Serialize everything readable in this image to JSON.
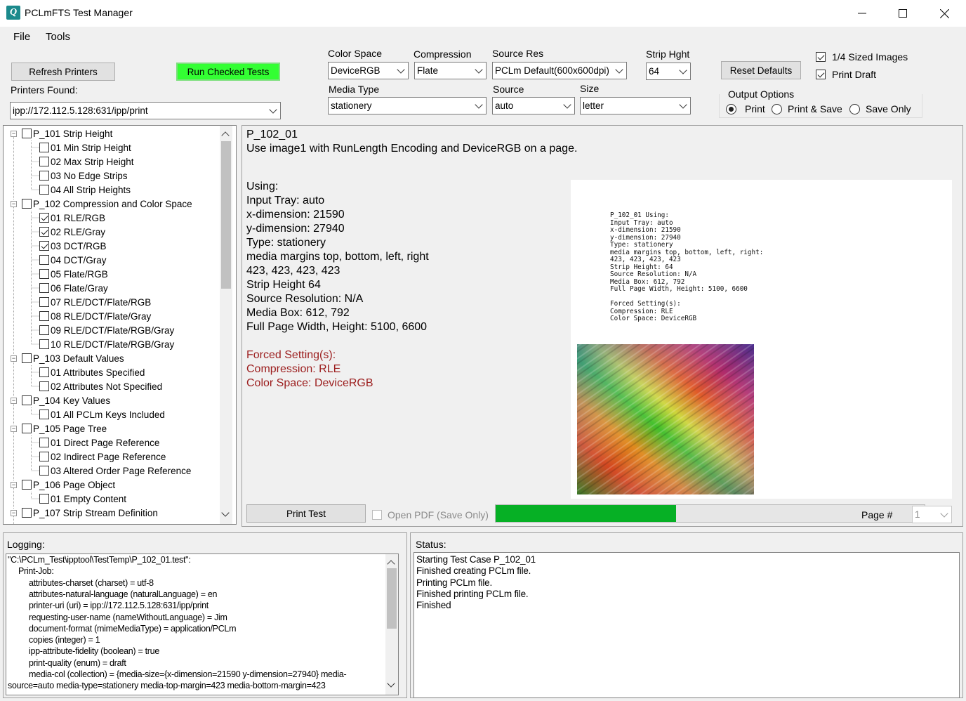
{
  "window": {
    "title": "PCLmFTS Test Manager",
    "app_icon_glyph": "Q",
    "controls": {
      "minimize": "minimize-icon",
      "maximize": "maximize-icon",
      "close": "close-icon"
    }
  },
  "menu": {
    "items": [
      "File",
      "Tools"
    ]
  },
  "toolbar": {
    "refresh_label": "Refresh Printers",
    "run_label": "Run Checked Tests",
    "run_color": "#33ff33",
    "printers_found_label": "Printers Found:",
    "printer": "ipp://172.112.5.128:631/ipp/print",
    "reset_label": "Reset Defaults",
    "color_space": {
      "label": "Color Space",
      "value": "DeviceRGB"
    },
    "compression": {
      "label": "Compression",
      "value": "Flate"
    },
    "source_res": {
      "label": "Source Res",
      "value": "PCLm Default(600x600dpi)"
    },
    "strip_height": {
      "label": "Strip Hght",
      "value": "64"
    },
    "media_type": {
      "label": "Media Type",
      "value": "stationery"
    },
    "source": {
      "label": "Source",
      "value": "auto"
    },
    "size": {
      "label": "Size",
      "value": "letter"
    },
    "quarter_sized": {
      "label": "1/4 Sized Images",
      "checked": true
    },
    "print_draft": {
      "label": "Print Draft",
      "checked": true
    },
    "output_options": {
      "label": "Output Options",
      "options": [
        "Print",
        "Print & Save",
        "Save Only"
      ],
      "selected": "Print"
    }
  },
  "tree": {
    "items": [
      {
        "label": "P_101 Strip Height",
        "level": 0,
        "checked": false
      },
      {
        "label": "01 Min Strip Height",
        "level": 1,
        "checked": false
      },
      {
        "label": "02 Max Strip Height",
        "level": 1,
        "checked": false
      },
      {
        "label": "03 No Edge Strips",
        "level": 1,
        "checked": false
      },
      {
        "label": "04 All Strip Heights",
        "level": 1,
        "checked": false
      },
      {
        "label": "P_102 Compression and Color Space",
        "level": 0,
        "checked": false
      },
      {
        "label": "01 RLE/RGB",
        "level": 1,
        "checked": true
      },
      {
        "label": "02 RLE/Gray",
        "level": 1,
        "checked": true
      },
      {
        "label": "03 DCT/RGB",
        "level": 1,
        "checked": true
      },
      {
        "label": "04 DCT/Gray",
        "level": 1,
        "checked": false
      },
      {
        "label": "05 Flate/RGB",
        "level": 1,
        "checked": false
      },
      {
        "label": "06 Flate/Gray",
        "level": 1,
        "checked": false
      },
      {
        "label": "07 RLE/DCT/Flate/RGB",
        "level": 1,
        "checked": false
      },
      {
        "label": "08 RLE/DCT/Flate/Gray",
        "level": 1,
        "checked": false
      },
      {
        "label": "09 RLE/DCT/Flate/RGB/Gray",
        "level": 1,
        "checked": false
      },
      {
        "label": "10 RLE/DCT/Flate/RGB/Gray",
        "level": 1,
        "checked": false
      },
      {
        "label": "P_103 Default Values",
        "level": 0,
        "checked": false
      },
      {
        "label": "01 Attributes Specified",
        "level": 1,
        "checked": false
      },
      {
        "label": "02 Attributes Not Specified",
        "level": 1,
        "checked": false
      },
      {
        "label": "P_104 Key Values",
        "level": 0,
        "checked": false
      },
      {
        "label": "01 All PCLm Keys Included",
        "level": 1,
        "checked": false
      },
      {
        "label": "P_105 Page Tree",
        "level": 0,
        "checked": false
      },
      {
        "label": "01 Direct Page Reference",
        "level": 1,
        "checked": false
      },
      {
        "label": "02 Indirect Page Reference",
        "level": 1,
        "checked": false
      },
      {
        "label": "03 Altered Order Page Reference",
        "level": 1,
        "checked": false
      },
      {
        "label": "P_106 Page Object",
        "level": 0,
        "checked": false
      },
      {
        "label": "01 Empty Content",
        "level": 1,
        "checked": false
      },
      {
        "label": "P_107 Strip Stream Definition",
        "level": 0,
        "checked": false
      }
    ]
  },
  "detail": {
    "test_id": "P_102_01",
    "description": "Use image1 with RunLength Encoding and DeviceRGB on a page.",
    "using": [
      "Using:",
      "Input Tray: auto",
      "x-dimension: 21590",
      "y-dimension: 27940",
      "Type: stationery",
      "media margins top, bottom, left, right",
      "423, 423, 423, 423",
      "Strip Height 64",
      "Source Resolution: N/A",
      "Media Box: 612, 792",
      "Full Page Width, Height: 5100, 6600"
    ],
    "forced": [
      "Forced Setting(s):",
      "Compression: RLE",
      "Color Space: DeviceRGB"
    ],
    "preview_text": [
      "P_102_01 Using:",
      "Input Tray: auto",
      "x-dimension: 21590",
      "y-dimension: 27940",
      "Type: stationery",
      "media margins top, bottom, left, right:",
      "423, 423, 423, 423",
      "Strip Height: 64",
      "Source Resolution: N/A",
      "Media Box: 612, 792",
      "Full Page Width, Height: 5100, 6600",
      "",
      "Forced Setting(s):",
      "Compression: RLE",
      "Color Space: DeviceRGB"
    ],
    "print_test_label": "Print Test",
    "open_pdf_label": "Open PDF (Save Only)",
    "open_pdf_checked": false,
    "progress_percent": 42,
    "progress_color": "#06b025",
    "page_label": "Page #",
    "page_value": "1"
  },
  "logging": {
    "label": "Logging:",
    "lines": [
      "\"C:\\PCLm_Test\\ipptool\\TestTemp\\P_102_01.test\":",
      "Print-Job:",
      "attributes-charset (charset) = utf-8",
      "attributes-natural-language (naturalLanguage) = en",
      "printer-uri (uri) = ipp://172.112.5.128:631/ipp/print",
      "requesting-user-name (nameWithoutLanguage) = Jim",
      "document-format (mimeMediaType) = application/PCLm",
      "copies (integer) = 1",
      "ipp-attribute-fidelity (boolean) = true",
      "print-quality (enum) = draft",
      "media-col (collection) = {media-size={x-dimension=21590 y-dimension=27940} media-",
      "source=auto media-type=stationery media-top-margin=423 media-bottom-margin=423"
    ],
    "indents": [
      0,
      1,
      2,
      2,
      2,
      2,
      2,
      2,
      2,
      2,
      2,
      0
    ]
  },
  "status": {
    "label": "Status:",
    "lines": [
      "Starting Test Case P_102_01",
      "Finished creating PCLm file.",
      "Printing PCLm file.",
      "Finished printing PCLm file.",
      "Finished"
    ]
  }
}
